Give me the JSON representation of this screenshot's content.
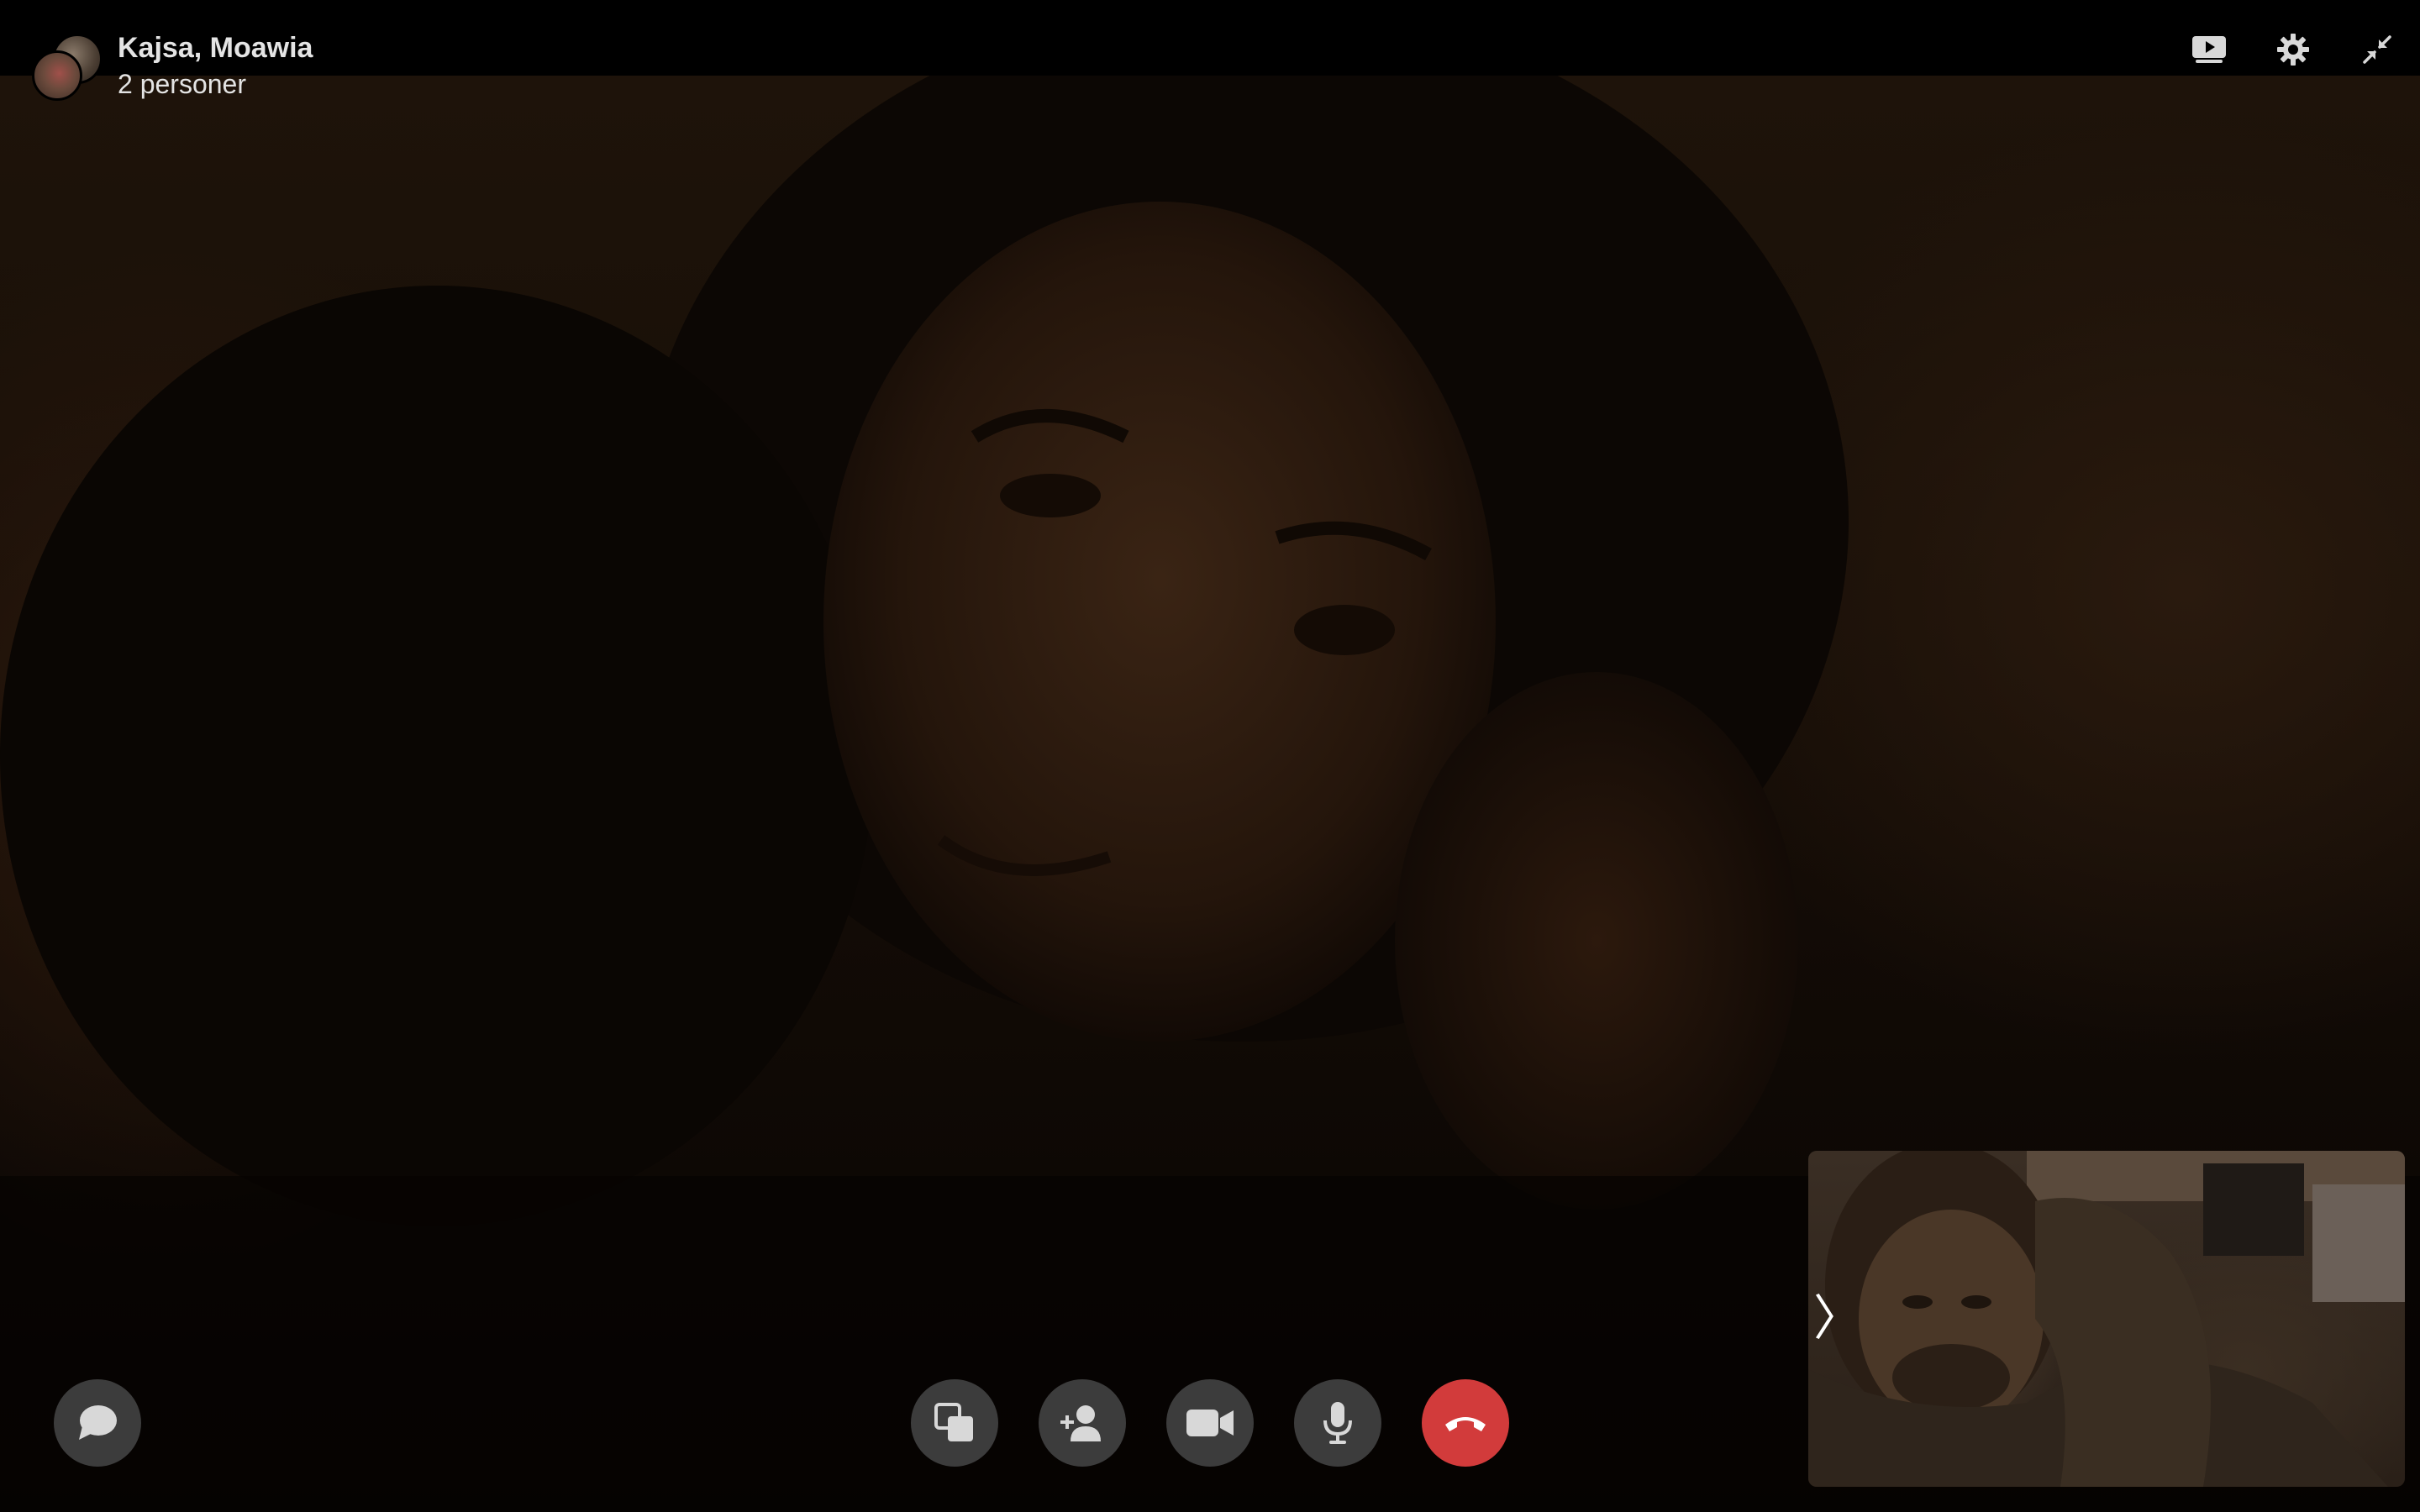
{
  "window": {
    "title": "Kajsa, Moawia",
    "subtitle": "2 personer"
  },
  "participants": [
    {
      "name": "Kajsa",
      "avatar": "avatar-kajsa"
    },
    {
      "name": "Moawia",
      "avatar": "avatar-moawia"
    }
  ],
  "top_controls": [
    {
      "name": "screen-share-icon"
    },
    {
      "name": "settings-gear-icon"
    },
    {
      "name": "minimize-arrows-icon"
    }
  ],
  "bottom_controls": [
    {
      "name": "chat-bubble-icon"
    },
    {
      "name": "switch-window-icon"
    },
    {
      "name": "add-person-icon"
    },
    {
      "name": "video-camera-icon"
    },
    {
      "name": "microphone-icon"
    },
    {
      "name": "end-call-icon"
    }
  ],
  "self_view": {
    "toggle_glyph": "〉"
  },
  "colors": {
    "top_bar": "#000000",
    "text": "#e4e4e4",
    "control_bg": "#3c3c3c",
    "end_call": "#d23b3b",
    "icon": "#d8d8d8"
  }
}
